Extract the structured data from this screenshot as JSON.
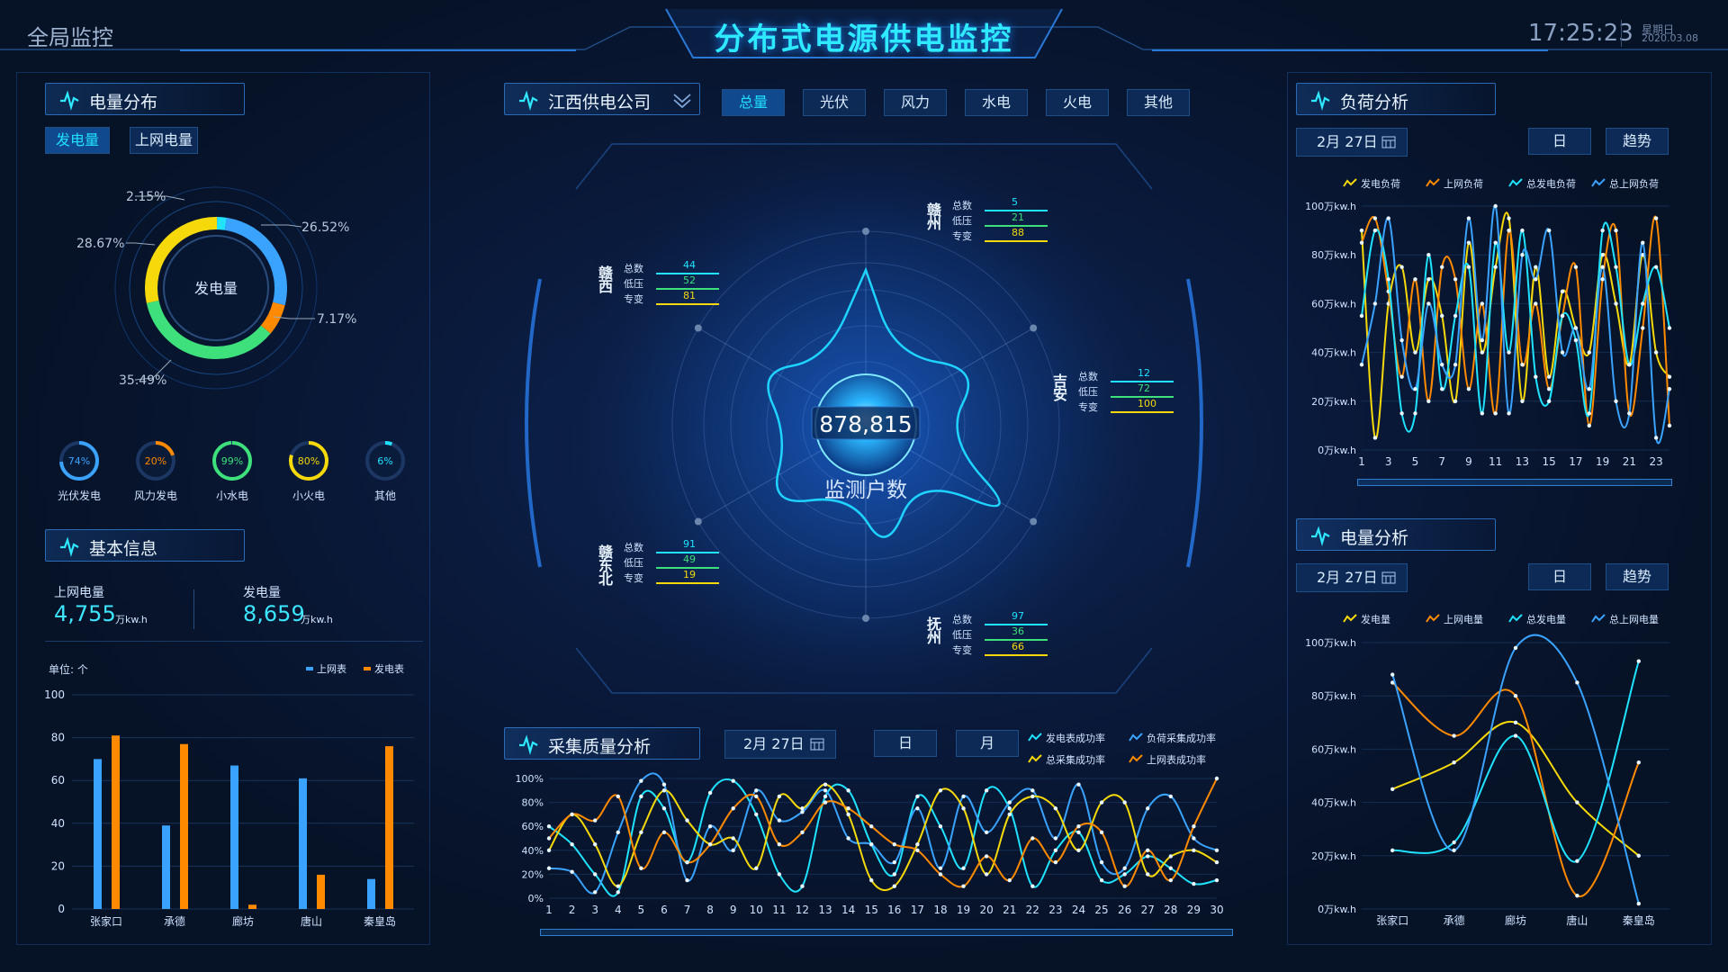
{
  "header": {
    "left_label": "全局监控",
    "title": "分布式电源供电监控",
    "time": "17:25:23",
    "weekday": "星期日",
    "date": "2020.03.08"
  },
  "colors": {
    "blue": "#3aa3ff",
    "cyan": "#1fe3ff",
    "yellow": "#f5d90a",
    "orange": "#ff8a00",
    "green": "#3de07a",
    "gray": "#8aa0c0"
  },
  "power_distribution": {
    "title": "电量分布",
    "tabs": [
      "发电量",
      "上网电量"
    ],
    "center_label": "发电量",
    "slices": [
      {
        "pct": "26.52%",
        "value": 26.52,
        "color": "#3aa3ff"
      },
      {
        "pct": "7.17%",
        "value": 7.17,
        "color": "#ff8a00"
      },
      {
        "pct": "35.49%",
        "value": 35.49,
        "color": "#3de07a"
      },
      {
        "pct": "28.67%",
        "value": 28.67,
        "color": "#f5d90a"
      },
      {
        "pct": "2.15%",
        "value": 2.15,
        "color": "#1fe3ff"
      }
    ],
    "gauges": [
      {
        "pct": "74%",
        "value": 74,
        "label": "光伏发电",
        "color": "#3aa3ff"
      },
      {
        "pct": "20%",
        "value": 20,
        "label": "风力发电",
        "color": "#ff8a00"
      },
      {
        "pct": "99%",
        "value": 99,
        "label": "小水电",
        "color": "#3de07a"
      },
      {
        "pct": "80%",
        "value": 80,
        "label": "小火电",
        "color": "#f5d90a"
      },
      {
        "pct": "6%",
        "value": 6,
        "label": "其他",
        "color": "#1fe3ff"
      }
    ]
  },
  "basic_info": {
    "title": "基本信息",
    "stats": [
      {
        "label": "上网电量",
        "value": "4,755",
        "unit": "万kw.h"
      },
      {
        "label": "发电量",
        "value": "8,659",
        "unit": "万kw.h"
      }
    ],
    "unit_label": "单位: 个",
    "legend": [
      "上网表",
      "发电表"
    ]
  },
  "center": {
    "company": "江西供电公司",
    "tabs": [
      "总量",
      "光伏",
      "风力",
      "水电",
      "火电",
      "其他"
    ],
    "active_tab": 0,
    "total": "878,815",
    "total_label": "监测户数",
    "row_labels": [
      "总数",
      "低压",
      "专变"
    ],
    "regions": [
      {
        "name": "赣州",
        "values": [
          "5",
          "21",
          "88"
        ]
      },
      {
        "name": "吉安",
        "values": [
          "12",
          "72",
          "100"
        ]
      },
      {
        "name": "抚州",
        "values": [
          "97",
          "36",
          "66"
        ]
      },
      {
        "name": "赣东北",
        "values": [
          "91",
          "49",
          "19"
        ]
      },
      {
        "name": "赣西",
        "values": [
          "44",
          "52",
          "81"
        ]
      }
    ]
  },
  "quality": {
    "title": "采集质量分析",
    "date": "2月 27日",
    "day_btn": "日",
    "month_btn": "月",
    "legend": [
      "发电表成功率",
      "负荷采集成功率",
      "总采集成功率",
      "上网表成功率"
    ]
  },
  "load_analysis": {
    "title": "负荷分析",
    "date": "2月 27日",
    "day_btn": "日",
    "trend_btn": "趋势",
    "legend": [
      "发电负荷",
      "上网负荷",
      "总发电负荷",
      "总上网负荷"
    ]
  },
  "energy_analysis": {
    "title": "电量分析",
    "date": "2月 27日",
    "day_btn": "日",
    "trend_btn": "趋势",
    "legend": [
      "发电量",
      "上网电量",
      "总发电量",
      "总上网电量"
    ]
  },
  "chart_data": [
    {
      "id": "meters",
      "type": "bar",
      "categories": [
        "张家口",
        "承德",
        "廊坊",
        "唐山",
        "秦皇岛"
      ],
      "series": [
        {
          "name": "上网表",
          "values": [
            70,
            39,
            67,
            61,
            14
          ],
          "color": "#3aa3ff"
        },
        {
          "name": "发电表",
          "values": [
            81,
            77,
            2,
            16,
            76
          ],
          "color": "#ff8a00"
        }
      ],
      "ylim": [
        0,
        100
      ],
      "yticks": [
        "0",
        "20",
        "40",
        "60",
        "80",
        "100"
      ]
    },
    {
      "id": "quality",
      "type": "line",
      "x": [
        "1",
        "2",
        "3",
        "4",
        "5",
        "6",
        "7",
        "8",
        "9",
        "10",
        "11",
        "12",
        "13",
        "14",
        "15",
        "16",
        "17",
        "18",
        "19",
        "20",
        "21",
        "22",
        "23",
        "24",
        "25",
        "26",
        "27",
        "28",
        "29",
        "30"
      ],
      "ylim": [
        0,
        100
      ],
      "yticks": [
        "0%",
        "20%",
        "40%",
        "60%",
        "80%",
        "100%"
      ],
      "series": [
        {
          "name": "发电表成功率",
          "color": "#1fe3ff",
          "values": [
            60,
            45,
            20,
            5,
            85,
            75,
            30,
            88,
            98,
            70,
            20,
            10,
            85,
            90,
            45,
            20,
            85,
            60,
            25,
            90,
            75,
            10,
            40,
            55,
            15,
            20,
            35,
            25,
            12,
            15
          ]
        },
        {
          "name": "负荷采集成功率",
          "color": "#3aa3ff",
          "values": [
            25,
            22,
            5,
            55,
            98,
            95,
            15,
            60,
            40,
            90,
            65,
            72,
            90,
            50,
            45,
            30,
            75,
            25,
            85,
            55,
            80,
            90,
            50,
            95,
            30,
            25,
            75,
            85,
            50,
            40
          ]
        },
        {
          "name": "总采集成功率",
          "color": "#f5d90a",
          "values": [
            40,
            70,
            45,
            10,
            55,
            90,
            65,
            45,
            50,
            25,
            85,
            75,
            95,
            70,
            15,
            10,
            45,
            90,
            75,
            20,
            70,
            85,
            75,
            40,
            80,
            80,
            20,
            35,
            40,
            30
          ]
        },
        {
          "name": "上网表成功率",
          "color": "#ff8a00",
          "values": [
            50,
            70,
            65,
            85,
            25,
            55,
            30,
            45,
            75,
            85,
            45,
            55,
            80,
            75,
            60,
            45,
            40,
            20,
            10,
            35,
            15,
            50,
            30,
            60,
            55,
            10,
            40,
            15,
            60,
            100
          ]
        }
      ]
    },
    {
      "id": "load",
      "type": "line",
      "x": [
        "1",
        "2",
        "3",
        "4",
        "5",
        "6",
        "7",
        "8",
        "9",
        "10",
        "11",
        "12",
        "13",
        "14",
        "15",
        "16",
        "17",
        "18",
        "19",
        "20",
        "21",
        "22",
        "23",
        "24"
      ],
      "xticks": [
        "1",
        "3",
        "5",
        "7",
        "9",
        "11",
        "13",
        "15",
        "17",
        "19",
        "21",
        "23"
      ],
      "ylim": [
        0,
        100
      ],
      "yticks": [
        "0万kw.h",
        "20万kw.h",
        "40万kw.h",
        "60万kw.h",
        "80万kw.h",
        "100万kw.h"
      ],
      "series": [
        {
          "name": "发电负荷",
          "color": "#f5d90a",
          "values": [
            90,
            5,
            60,
            75,
            40,
            70,
            55,
            20,
            85,
            40,
            75,
            95,
            20,
            75,
            30,
            65,
            50,
            40,
            80,
            60,
            35,
            80,
            40,
            30
          ]
        },
        {
          "name": "上网负荷",
          "color": "#ff8a00",
          "values": [
            85,
            95,
            65,
            30,
            70,
            20,
            75,
            70,
            25,
            60,
            15,
            90,
            35,
            60,
            25,
            55,
            75,
            10,
            70,
            90,
            15,
            50,
            95,
            10
          ]
        },
        {
          "name": "总发电负荷",
          "color": "#1fe3ff",
          "values": [
            55,
            90,
            70,
            15,
            15,
            80,
            25,
            55,
            75,
            15,
            85,
            40,
            90,
            30,
            20,
            55,
            45,
            15,
            90,
            75,
            35,
            60,
            75,
            50
          ]
        },
        {
          "name": "总上网负荷",
          "color": "#3aa3ff",
          "values": [
            35,
            60,
            95,
            45,
            25,
            60,
            35,
            35,
            95,
            45,
            100,
            15,
            80,
            70,
            90,
            40,
            50,
            25,
            75,
            20,
            15,
            85,
            5,
            25
          ]
        }
      ]
    },
    {
      "id": "energy",
      "type": "line",
      "categories": [
        "张家口",
        "承德",
        "廊坊",
        "唐山",
        "秦皇岛"
      ],
      "ylim": [
        0,
        100
      ],
      "yticks": [
        "0万kw.h",
        "20万kw.h",
        "40万kw.h",
        "60万kw.h",
        "80万kw.h",
        "100万kw.h"
      ],
      "series": [
        {
          "name": "发电量",
          "color": "#f5d90a",
          "values": [
            45,
            55,
            70,
            40,
            20
          ]
        },
        {
          "name": "上网电量",
          "color": "#ff8a00",
          "values": [
            85,
            65,
            80,
            5,
            55
          ]
        },
        {
          "name": "总发电量",
          "color": "#1fe3ff",
          "values": [
            22,
            25,
            65,
            18,
            93
          ]
        },
        {
          "name": "总上网电量",
          "color": "#3aa3ff",
          "values": [
            88,
            22,
            98,
            85,
            2
          ]
        }
      ]
    }
  ]
}
